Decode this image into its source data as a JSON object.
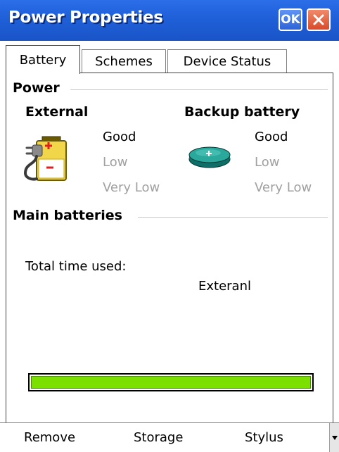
{
  "window": {
    "title": "Power Properties",
    "ok_label": "OK"
  },
  "tabs": [
    {
      "label": "Battery",
      "active": true
    },
    {
      "label": "Schemes",
      "active": false
    },
    {
      "label": "Device Status",
      "active": false
    }
  ],
  "power": {
    "section_label": "Power",
    "external": {
      "heading": "External",
      "icon": "ac-plug-battery-icon",
      "levels": [
        "Good",
        "Low",
        "Very Low"
      ],
      "active_level": "Good"
    },
    "backup": {
      "heading": "Backup battery",
      "icon": "coin-cell-battery-icon",
      "levels": [
        "Good",
        "Low",
        "Very Low"
      ],
      "active_level": "Good"
    }
  },
  "main_batteries": {
    "section_label": "Main batteries",
    "total_time_label": "Total time used:",
    "source_text": "Exteranl",
    "progress_fraction": 1.0,
    "progress_color": "#7be000"
  },
  "softkeys": [
    "Remove",
    "Storage",
    "Stylus"
  ]
}
